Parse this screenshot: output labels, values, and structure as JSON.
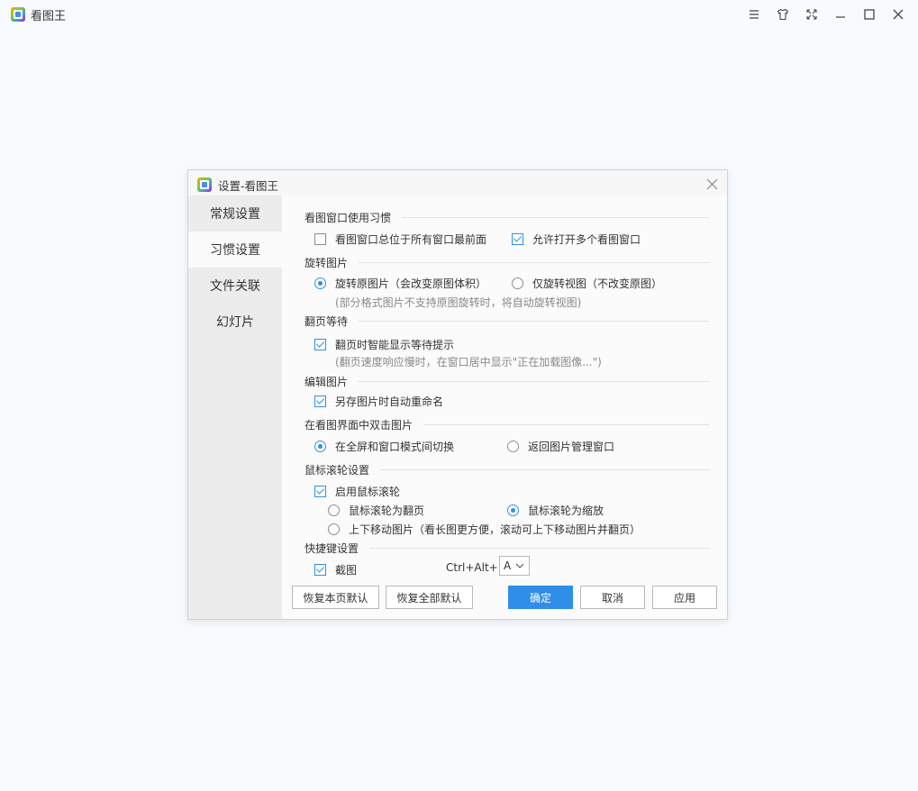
{
  "app": {
    "title": "看图王"
  },
  "dialog": {
    "title": "设置-看图王",
    "sidebar": [
      {
        "label": "常规设置",
        "active": false
      },
      {
        "label": "习惯设置",
        "active": true
      },
      {
        "label": "文件关联",
        "active": false
      },
      {
        "label": "幻灯片",
        "active": false
      }
    ],
    "sections": {
      "window_habit": {
        "title": "看图窗口使用习惯",
        "always_on_top": {
          "label": "看图窗口总位于所有窗口最前面",
          "checked": false
        },
        "allow_multiple": {
          "label": "允许打开多个看图窗口",
          "checked": true
        }
      },
      "rotate": {
        "title": "旋转图片",
        "rotate_original": {
          "label": "旋转原图片（会改变原图体积）",
          "checked": true
        },
        "rotate_view": {
          "label": "仅旋转视图（不改变原图）",
          "checked": false
        },
        "hint": "(部分格式图片不支持原图旋转时，将自动旋转视图)"
      },
      "page_wait": {
        "title": "翻页等待",
        "smart_wait": {
          "label": "翻页时智能显示等待提示",
          "checked": true
        },
        "hint": "(翻页速度响应慢时，在窗口居中显示\"正在加载图像...\")"
      },
      "edit": {
        "title": "编辑图片",
        "auto_rename": {
          "label": "另存图片时自动重命名",
          "checked": true
        }
      },
      "double_click": {
        "title": "在看图界面中双击图片",
        "toggle_fullscreen": {
          "label": "在全屏和窗口模式间切换",
          "checked": true
        },
        "return_manager": {
          "label": "返回图片管理窗口",
          "checked": false
        }
      },
      "wheel": {
        "title": "鼠标滚轮设置",
        "enable_wheel": {
          "label": "启用鼠标滚轮",
          "checked": true
        },
        "wheel_page": {
          "label": "鼠标滚轮为翻页",
          "checked": false
        },
        "wheel_zoom": {
          "label": "鼠标滚轮为缩放",
          "checked": true
        },
        "wheel_move": {
          "label": "上下移动图片（看长图更方便，滚动可上下移动图片并翻页）",
          "checked": false
        }
      },
      "shortcut": {
        "title": "快捷键设置",
        "screenshot": {
          "label": "截图",
          "checked": true
        },
        "combo_label": "Ctrl+Alt+",
        "key_value": "A"
      }
    },
    "buttons": {
      "restore_page": "恢复本页默认",
      "restore_all": "恢复全部默认",
      "ok": "确定",
      "cancel": "取消",
      "apply": "应用"
    }
  },
  "colors": {
    "accent": "#2f8ee8",
    "background": "#f7fbfe"
  }
}
